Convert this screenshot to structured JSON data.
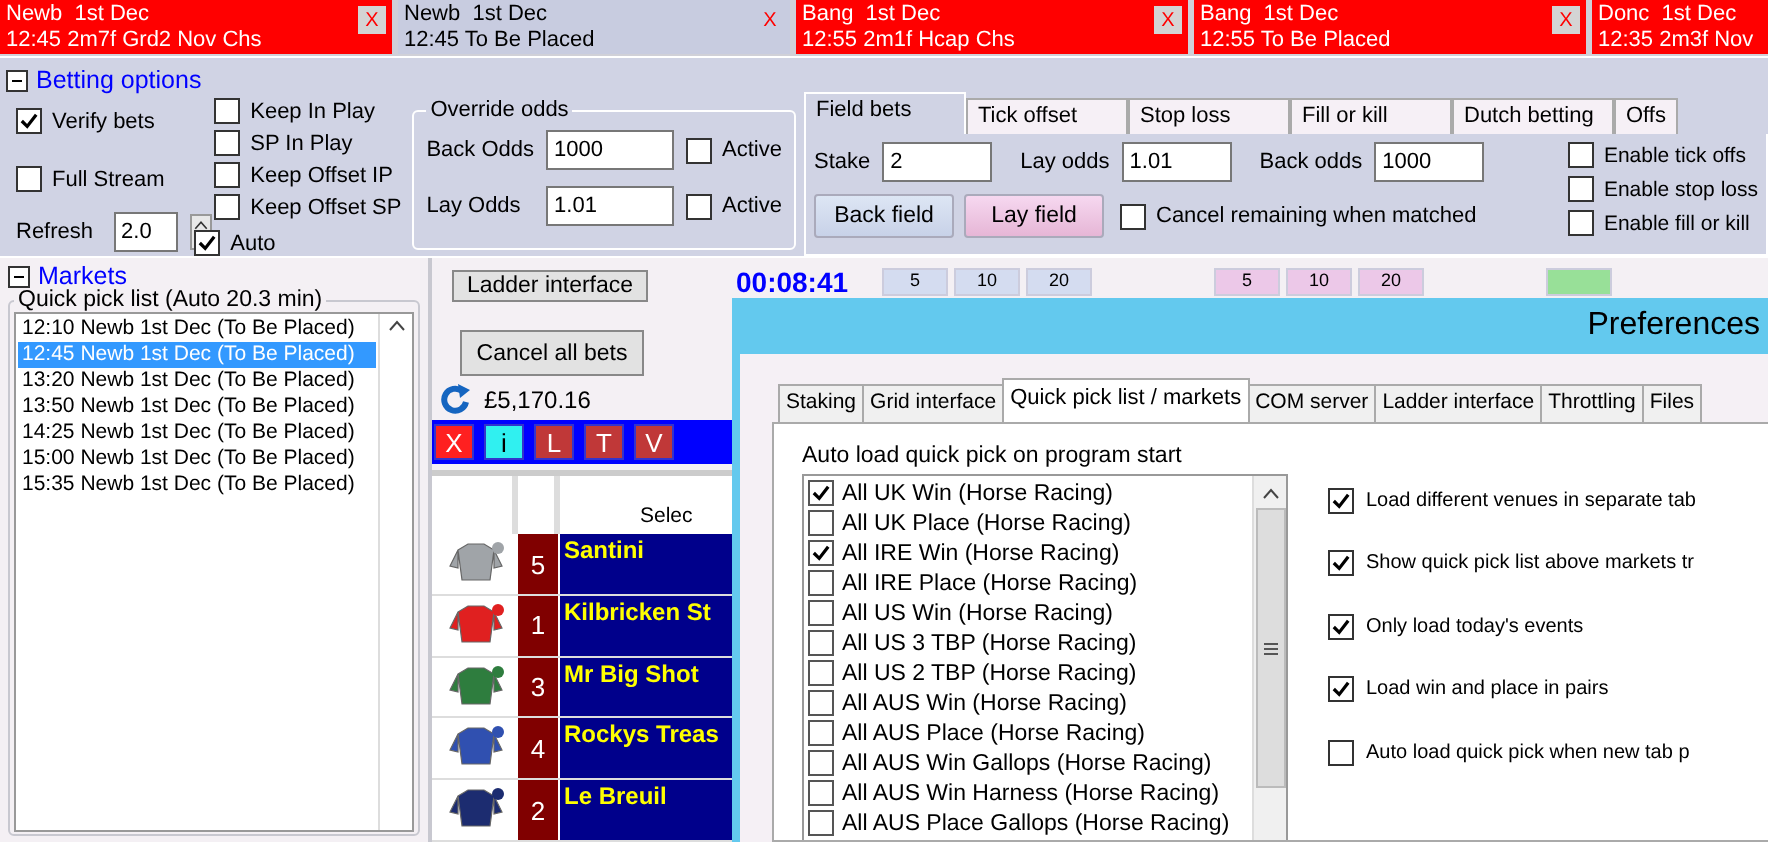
{
  "race_tabs": [
    {
      "venue": "Newb  1st Dec",
      "race": "12:45 2m7f Grd2 Nov Chs",
      "selected": false,
      "close": "X"
    },
    {
      "venue": "Newb  1st Dec",
      "race": "12:45 To Be Placed",
      "selected": true,
      "close": "X"
    },
    {
      "venue": "Bang  1st Dec",
      "race": "12:55 2m1f Hcap Chs",
      "selected": false,
      "close": "X"
    },
    {
      "venue": "Bang  1st Dec",
      "race": "12:55 To Be Placed",
      "selected": false,
      "close": "X"
    },
    {
      "venue": "Donc  1st Dec",
      "race": "12:35 2m3f Nov",
      "selected": false
    }
  ],
  "betting_options": {
    "title": "Betting options",
    "left_checks": [
      {
        "label": "Verify bets",
        "checked": true
      },
      {
        "label": "Full Stream",
        "checked": false
      }
    ],
    "keep_checks": [
      {
        "label": "Keep In Play",
        "checked": false
      },
      {
        "label": "SP In Play",
        "checked": false
      },
      {
        "label": "Keep Offset IP",
        "checked": false
      },
      {
        "label": "Keep Offset SP",
        "checked": false
      }
    ],
    "refresh": {
      "label": "Refresh",
      "value": "2.0"
    },
    "auto": {
      "label": "Auto",
      "checked": true
    },
    "override_odds": {
      "title": "Override odds",
      "rows": [
        {
          "label": "Back Odds",
          "value": "1000",
          "active_label": "Active",
          "active": false
        },
        {
          "label": "Lay Odds",
          "value": "1.01",
          "active_label": "Active",
          "active": false
        }
      ]
    }
  },
  "field_panel": {
    "tabs": [
      {
        "label": "Field bets",
        "selected": true
      },
      {
        "label": "Tick offset",
        "selected": false
      },
      {
        "label": "Stop loss",
        "selected": false
      },
      {
        "label": "Fill or kill",
        "selected": false
      },
      {
        "label": "Dutch betting",
        "selected": false
      },
      {
        "label": "Offs",
        "selected": false
      }
    ],
    "fields": [
      {
        "label": "Stake",
        "value": "2"
      },
      {
        "label": "Lay odds",
        "value": "1.01"
      },
      {
        "label": "Back odds",
        "value": "1000"
      }
    ],
    "buttons": [
      {
        "label": "Back field",
        "kind": "back"
      },
      {
        "label": "Lay field",
        "kind": "lay"
      }
    ],
    "cancel_remaining": {
      "label": "Cancel remaining when matched",
      "checked": false
    },
    "enable_checks": [
      {
        "label": "Enable tick offs",
        "checked": false
      },
      {
        "label": "Enable stop loss",
        "checked": false
      },
      {
        "label": "Enable fill or kill",
        "checked": false
      }
    ]
  },
  "markets": {
    "title": "Markets",
    "quick_pick": {
      "title": "Quick pick list (Auto 20.3 min)",
      "items": [
        {
          "label": "12:10 Newb 1st Dec (To Be Placed)",
          "selected": false
        },
        {
          "label": "12:45 Newb 1st Dec (To Be Placed)",
          "selected": true
        },
        {
          "label": "13:20 Newb 1st Dec (To Be Placed)",
          "selected": false
        },
        {
          "label": "13:50 Newb 1st Dec (To Be Placed)",
          "selected": false
        },
        {
          "label": "14:25 Newb 1st Dec (To Be Placed)",
          "selected": false
        },
        {
          "label": "15:00 Newb 1st Dec (To Be Placed)",
          "selected": false
        },
        {
          "label": "15:35 Newb 1st Dec (To Be Placed)",
          "selected": false
        }
      ]
    }
  },
  "ladder": {
    "ladder_button": "Ladder interface",
    "cancel_button": "Cancel all bets",
    "balance": "£5,170.16",
    "tool_buttons": [
      {
        "label": "X",
        "kind": "close"
      },
      {
        "label": "i",
        "kind": "info"
      },
      {
        "label": "L",
        "kind": "plain"
      },
      {
        "label": "T",
        "kind": "plain"
      },
      {
        "label": "V",
        "kind": "plain"
      }
    ],
    "header": {
      "column_3": "Selec"
    },
    "runners": [
      {
        "number": "5",
        "name": "Santini",
        "color": "#a0a4a8"
      },
      {
        "number": "1",
        "name": "Kilbricken St",
        "color": "#e02020"
      },
      {
        "number": "3",
        "name": "Mr Big Shot",
        "color": "#2e7d3e"
      },
      {
        "number": "4",
        "name": "Rockys Treas",
        "color": "#3050b0"
      },
      {
        "number": "2",
        "name": "Le Breuil",
        "color": "#1c2c70"
      }
    ]
  },
  "timer": "00:08:41",
  "stake_buttons": [
    {
      "label": "5",
      "kind": "back"
    },
    {
      "label": "10",
      "kind": "back"
    },
    {
      "label": "20",
      "kind": "back"
    },
    {
      "label": "5",
      "kind": "lay"
    },
    {
      "label": "10",
      "kind": "lay"
    },
    {
      "label": "20",
      "kind": "lay"
    },
    {
      "kind": "green"
    }
  ],
  "preferences": {
    "title": "Preferences",
    "tabs": [
      {
        "label": "Staking",
        "selected": false
      },
      {
        "label": "Grid interface",
        "selected": false
      },
      {
        "label": "Quick pick list / markets",
        "selected": true
      },
      {
        "label": "COM server",
        "selected": false
      },
      {
        "label": "Ladder interface",
        "selected": false
      },
      {
        "label": "Throttling",
        "selected": false
      },
      {
        "label": "Files",
        "selected": false
      }
    ],
    "list_label": "Auto load quick pick on program start",
    "markets": [
      {
        "label": "All UK Win (Horse Racing)",
        "checked": true
      },
      {
        "label": "All UK Place (Horse Racing)",
        "checked": false
      },
      {
        "label": "All IRE Win (Horse Racing)",
        "checked": true
      },
      {
        "label": "All IRE Place (Horse Racing)",
        "checked": false
      },
      {
        "label": "All US Win (Horse Racing)",
        "checked": false
      },
      {
        "label": "All US 3 TBP (Horse Racing)",
        "checked": false
      },
      {
        "label": "All US 2 TBP (Horse Racing)",
        "checked": false
      },
      {
        "label": "All AUS Win (Horse Racing)",
        "checked": false
      },
      {
        "label": "All AUS Place (Horse Racing)",
        "checked": false
      },
      {
        "label": "All AUS Win Gallops (Horse Racing)",
        "checked": false
      },
      {
        "label": "All AUS Win Harness (Horse Racing)",
        "checked": false
      },
      {
        "label": "All AUS Place Gallops (Horse Racing)",
        "checked": false
      }
    ],
    "options": [
      {
        "label": "Load different venues in separate tab",
        "checked": true
      },
      {
        "label": "Show quick pick list above markets tr",
        "checked": true
      },
      {
        "label": "Only load today's events",
        "checked": true
      },
      {
        "label": "Load win and place in pairs",
        "checked": true
      },
      {
        "label": "Auto load quick pick when new tab p",
        "checked": false
      }
    ]
  }
}
